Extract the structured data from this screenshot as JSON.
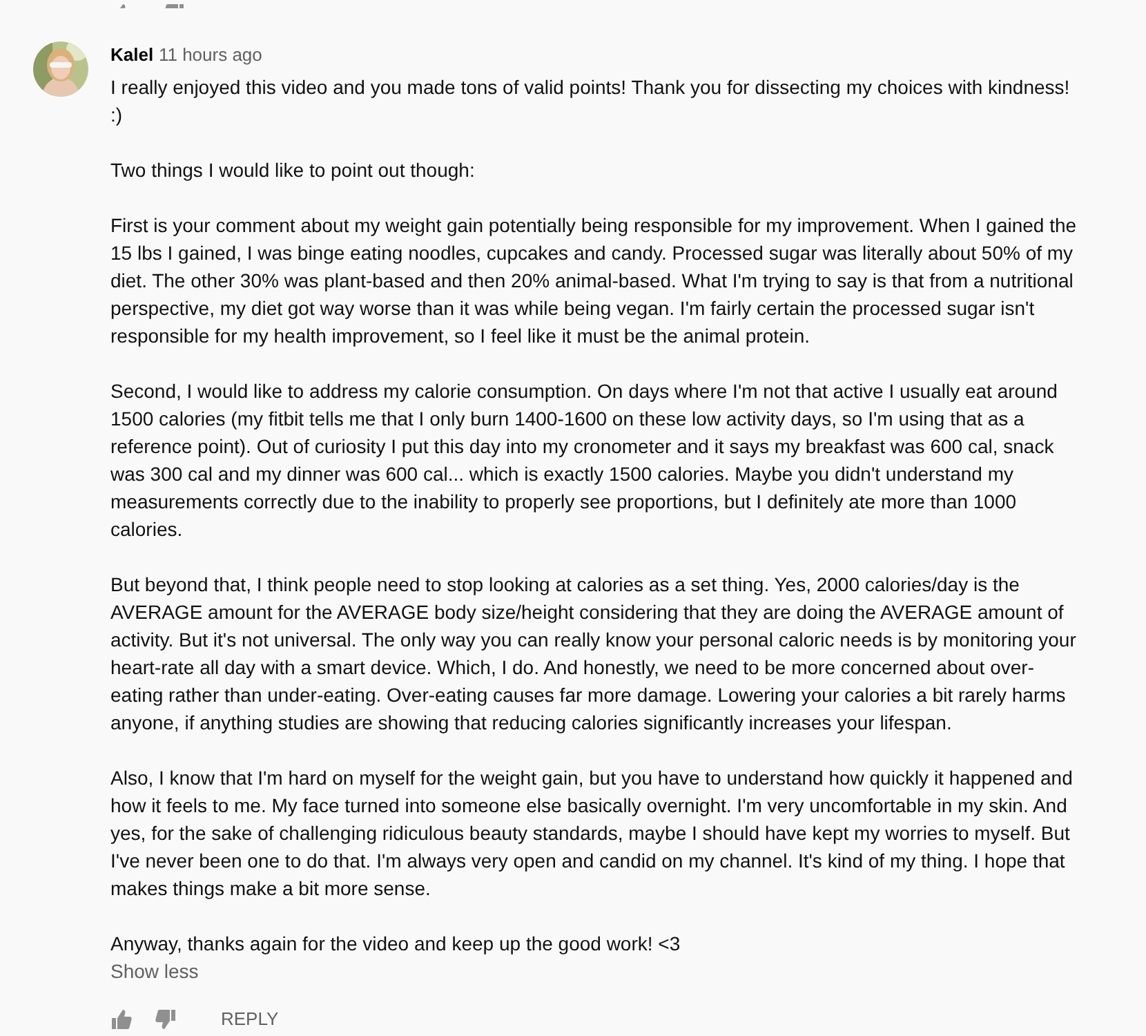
{
  "comment": {
    "author": "Kalel",
    "time": "11 hours ago",
    "paragraphs": [
      "I really enjoyed this video and you made tons of valid points! Thank you for dissecting my choices with kindness! :)",
      "Two things I would like to point out though:",
      "First is your comment about my weight gain potentially being responsible for my improvement. When I gained the 15 lbs I gained, I was binge eating noodles, cupcakes and candy. Processed sugar was literally about 50% of my diet. The other 30% was plant-based and then 20% animal-based. What I'm trying to say is that from a nutritional perspective, my diet got way worse than it was while being vegan. I'm fairly certain the processed sugar isn't responsible for my health improvement, so I feel like it must be the animal protein.",
      "Second, I would like to address my calorie consumption. On days where I'm not that active I usually eat around 1500 calories (my fitbit tells me that I only burn 1400-1600 on these low activity days, so I'm using that as a reference point). Out of curiosity I put this day into my cronometer and it says my breakfast was 600 cal, snack was 300 cal and my dinner was 600 cal... which is exactly 1500 calories. Maybe you didn't understand my measurements correctly due to the inability to properly see proportions, but I definitely ate more than 1000 calories.",
      "But beyond that, I think people need to stop looking at calories as a set thing. Yes, 2000 calories/day is the AVERAGE amount for the AVERAGE body size/height considering that they are doing the AVERAGE amount of activity. But it's not universal. The only way you can really know your personal caloric needs is by monitoring your heart-rate all day with a smart device. Which, I do. And honestly, we need to be more concerned about over-eating rather than under-eating. Over-eating causes far more damage. Lowering your calories a bit rarely harms anyone, if anything studies are showing that reducing calories significantly increases your lifespan.",
      "Also, I know that I'm hard on myself for the weight gain, but you have to understand how quickly it happened and how it feels to me. My face turned into someone else basically overnight. I'm very uncomfortable in my skin. And yes, for the sake of challenging ridiculous beauty standards, maybe I should have kept my worries to myself. But I've never been one to do that. I'm always very open and candid on my channel. It's kind of my thing. I hope that makes things make a bit more sense.",
      "Anyway, thanks again for the video and keep up the good work! <3"
    ],
    "toggle": "Show less",
    "reply": "REPLY"
  }
}
